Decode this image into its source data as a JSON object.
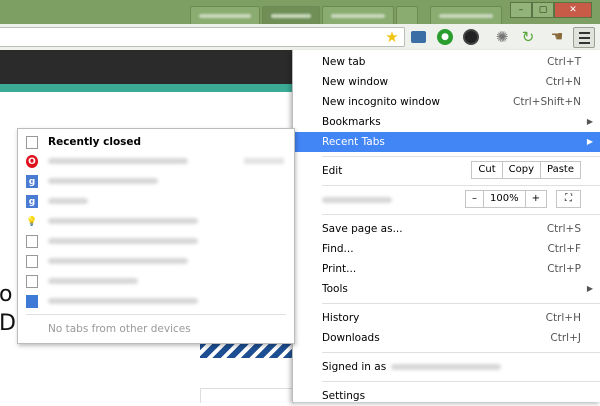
{
  "window": {
    "controls": {
      "minimize": "–",
      "maximize": "▢",
      "close": "✕"
    }
  },
  "toolbar": {
    "icons": [
      "star-icon",
      "camera-extension-icon",
      "green-extension-icon",
      "dark-extension-icon",
      "gear-extension-icon",
      "refresh-extension-icon",
      "cursor-extension-icon",
      "menu-icon"
    ]
  },
  "page": {
    "partial_text_1": "o",
    "partial_text_2": "D"
  },
  "menu": {
    "new_tab": {
      "label": "New tab",
      "shortcut": "Ctrl+T"
    },
    "new_window": {
      "label": "New window",
      "shortcut": "Ctrl+N"
    },
    "new_incognito": {
      "label": "New incognito window",
      "shortcut": "Ctrl+Shift+N"
    },
    "bookmarks": {
      "label": "Bookmarks"
    },
    "recent_tabs": {
      "label": "Recent Tabs"
    },
    "edit": {
      "label": "Edit",
      "cut": "Cut",
      "copy": "Copy",
      "paste": "Paste"
    },
    "zoom": {
      "minus": "–",
      "value": "100%",
      "plus": "+",
      "fullscreen": "⛶"
    },
    "save_page": {
      "label": "Save page as...",
      "shortcut": "Ctrl+S"
    },
    "find": {
      "label": "Find...",
      "shortcut": "Ctrl+F"
    },
    "print": {
      "label": "Print...",
      "shortcut": "Ctrl+P"
    },
    "tools": {
      "label": "Tools"
    },
    "history": {
      "label": "History",
      "shortcut": "Ctrl+H"
    },
    "downloads": {
      "label": "Downloads",
      "shortcut": "Ctrl+J"
    },
    "signed_in": {
      "label": "Signed in as"
    },
    "settings": {
      "label": "Settings"
    }
  },
  "recent": {
    "header": "Recently closed",
    "footer": "No tabs from other devices"
  },
  "colors": {
    "frame": "#7d9f63",
    "highlight": "#4285f4",
    "page_dark": "#2b2b2b",
    "page_teal": "#3bab96"
  }
}
